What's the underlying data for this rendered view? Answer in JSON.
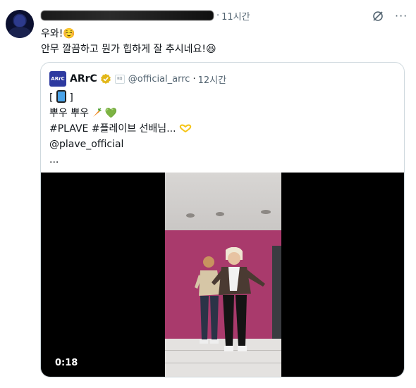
{
  "tweet": {
    "time": "11시간",
    "text_line1": "우와!☺️",
    "text_line2": "안무 깔끔하고 뭔가 힙하게 잘 추시네요!😆"
  },
  "quote": {
    "logo_text": "ARrC",
    "name": "ARrC",
    "affiliate_text": "KQ",
    "handle": "@official_arrc",
    "time": "12시간",
    "line_bracket_open": "[",
    "line_bracket_close": "]",
    "line2_text": "뿌우 뿌우",
    "line2_heart": "💚",
    "line3_text": "#PLAVE #플레이브 선배님...",
    "line4_text": "@plave_official",
    "line5_text": "..."
  },
  "video": {
    "timestamp": "0:18"
  },
  "icons": {
    "grok": "grok-icon",
    "more": "more-icon",
    "verified": "verified-badge-icon"
  },
  "colors": {
    "secondary_text": "#536471",
    "border": "#cfd9de",
    "verified_gold": "#e2b719",
    "wall": "#a93a6c"
  }
}
